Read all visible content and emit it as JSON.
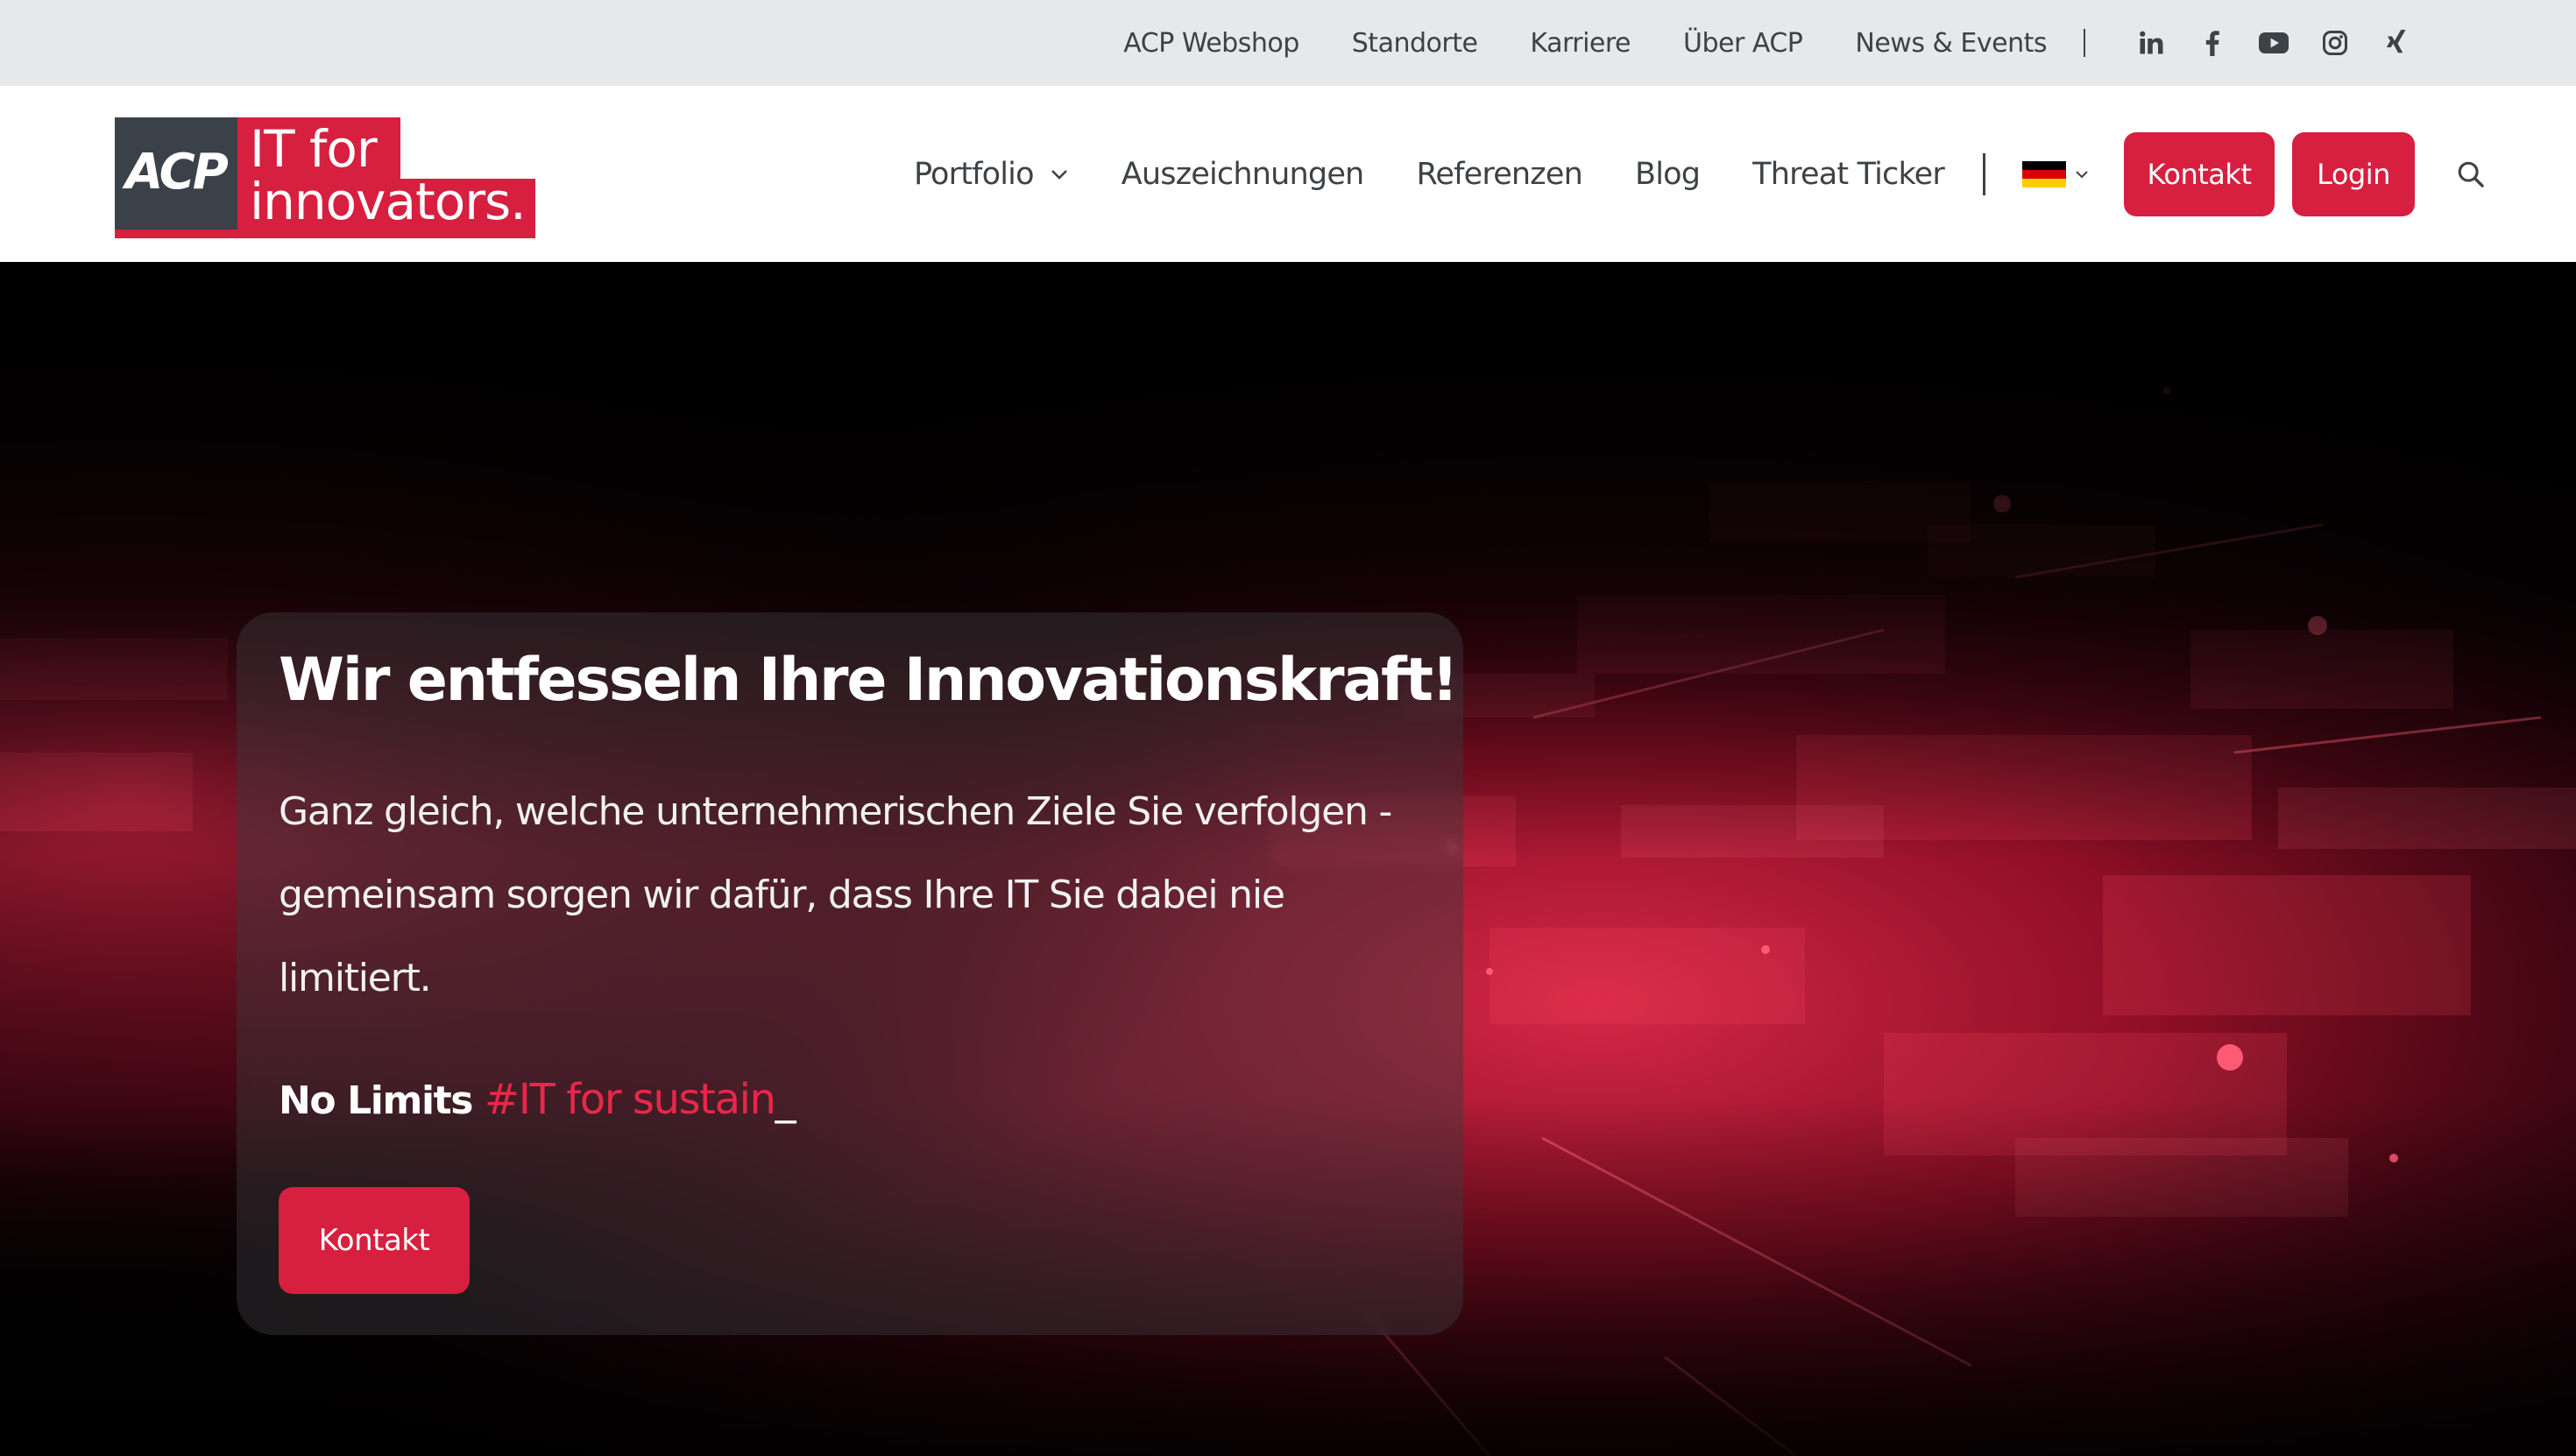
{
  "topbar": {
    "links": [
      "ACP Webshop",
      "Standorte",
      "Karriere",
      "Über ACP",
      "News & Events"
    ],
    "social": [
      "linkedin-icon",
      "facebook-icon",
      "youtube-icon",
      "instagram-icon",
      "xing-icon"
    ]
  },
  "logo": {
    "badge": "ACP",
    "line1": "IT for",
    "line2": "innovators."
  },
  "nav": {
    "items": [
      "Portfolio",
      "Auszeichnungen",
      "Referenzen",
      "Blog",
      "Threat Ticker"
    ],
    "language_icon": "flag-de-icon",
    "kontakt": "Kontakt",
    "login": "Login",
    "search_icon": "search-icon"
  },
  "hero": {
    "title": "Wir entfesseln Ihre Innovationskraft!",
    "text_line1": "Ganz gleich, welche unternehmerischen Ziele Sie verfolgen -",
    "text_line2": "gemeinsam sorgen wir dafür, dass Ihre IT Sie dabei nie limitiert.",
    "tag_static": "No Limits",
    "tag_dynamic": "#IT for sustain",
    "tag_cursor": "_",
    "button": "Kontakt"
  },
  "colors": {
    "brand_red": "#d71f3f",
    "dark_grey": "#3b4148",
    "topbar_bg": "#e7e8ea"
  }
}
